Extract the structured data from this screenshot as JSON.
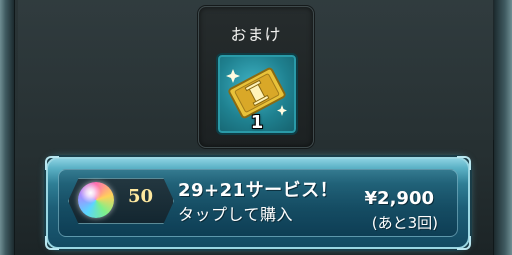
{
  "bonus": {
    "title": "おまけ",
    "item_icon": "orb-ticket-icon",
    "item_count": "1"
  },
  "purchase": {
    "orb_icon": "rainbow-orb-icon",
    "orb_count": "50",
    "offer_title": "29+21サービス！",
    "offer_subtitle": "タップして購入",
    "price": "¥2,900",
    "remaining": "(あと3回)"
  },
  "colors": {
    "accent": "#2f7f96",
    "tile": "#1f8190",
    "gold": "#e8c23a",
    "orb_count": "#ffe9a0"
  }
}
